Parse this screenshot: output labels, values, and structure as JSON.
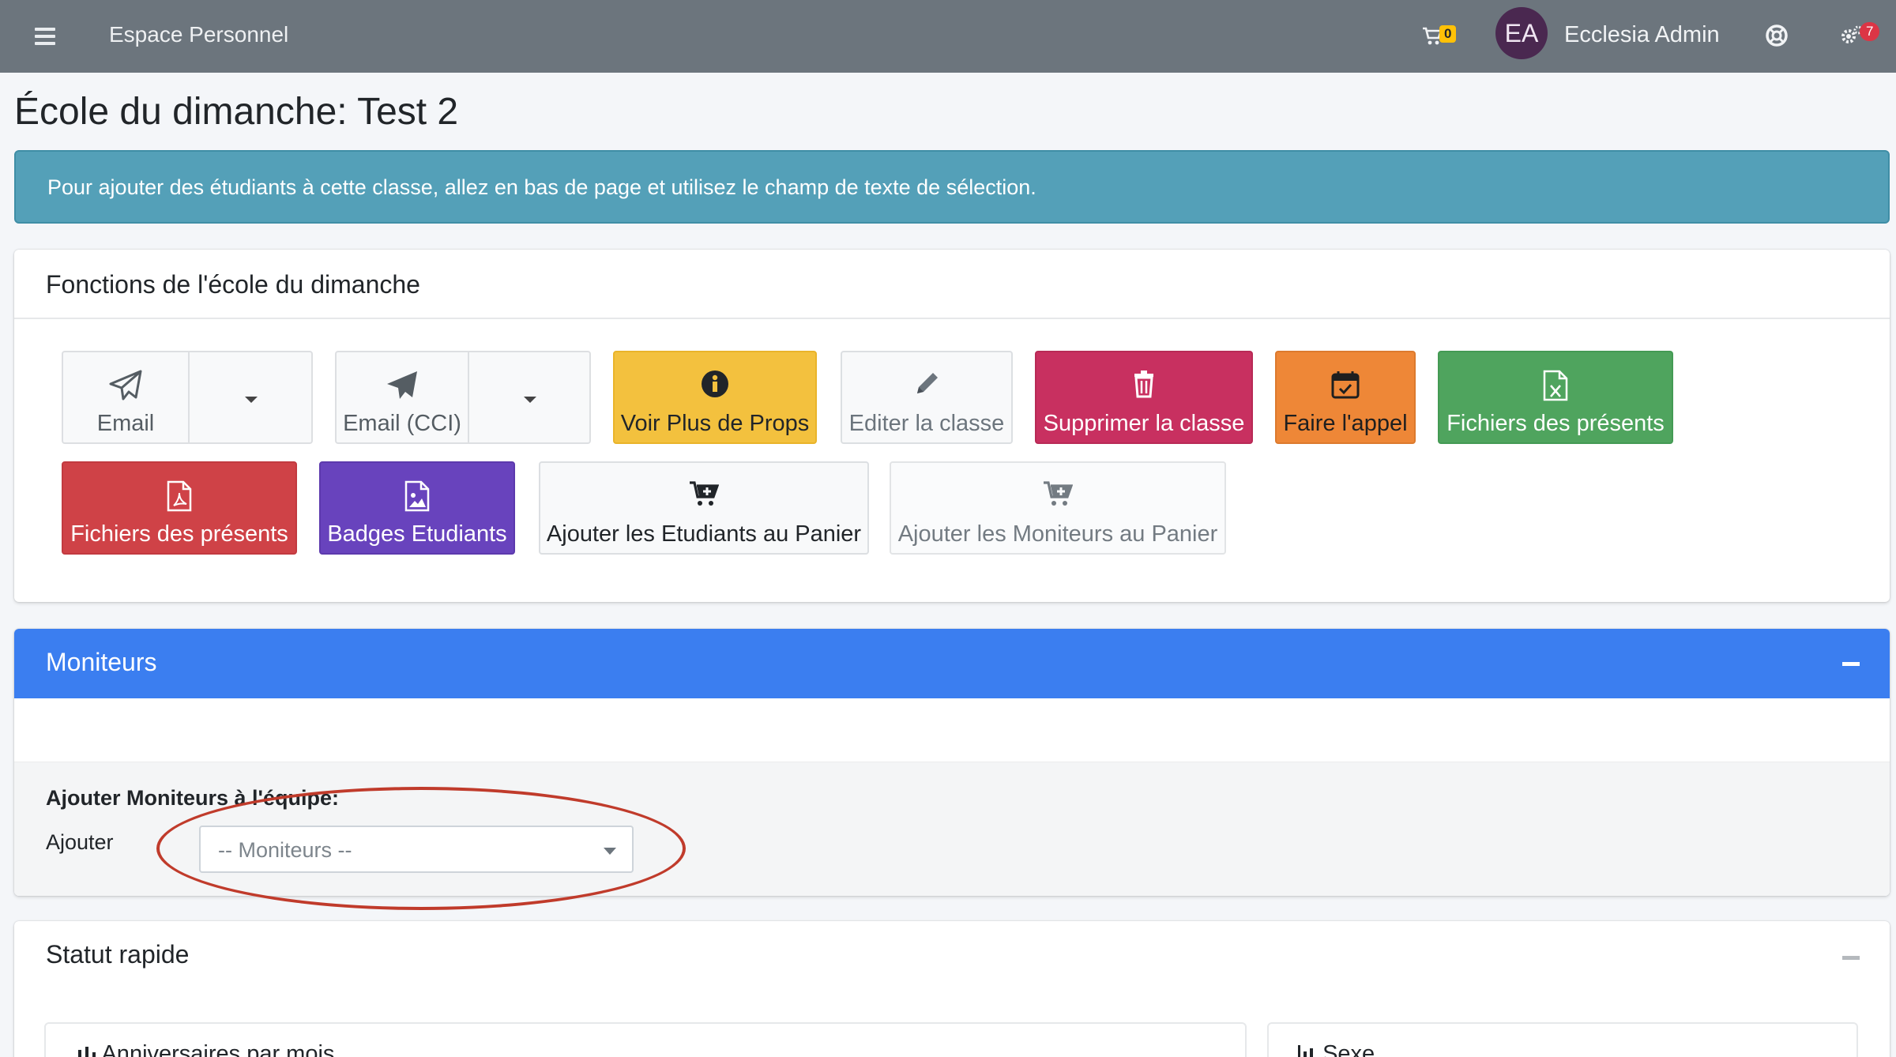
{
  "navbar": {
    "menu_icon": "bars-icon",
    "brand": "Espace Personnel",
    "cart_count": "0",
    "avatar_initials": "EA",
    "user_name": "Ecclesia Admin",
    "help_icon": "life-ring-icon",
    "gear_badge": "7"
  },
  "page": {
    "title": "École du dimanche: Test 2"
  },
  "alert": {
    "text": "Pour ajouter des étudiants à cette classe, allez en bas de page et utilisez le champ de texte de sélection."
  },
  "functions_card": {
    "title": "Fonctions de l'école du dimanche",
    "buttons": {
      "email": "Email",
      "email_bcc": "Email (CCI)",
      "view_props": "Voir Plus de Props",
      "edit_class": "Editer la classe",
      "delete_class": "Supprimer la classe",
      "attendance": "Faire l'appel",
      "attendance_xls": "Fichiers des présents",
      "attendance_pdf": "Fichiers des présents",
      "badges": "Badges Etudiants",
      "add_students_cart": "Ajouter les Etudiants au Panier",
      "add_monitors_cart": "Ajouter les Moniteurs au Panier"
    }
  },
  "monitors_card": {
    "title": "Moniteurs",
    "add_title": "Ajouter Moniteurs à l'équipe:",
    "add_label": "Ajouter",
    "select_placeholder": "-- Moniteurs --"
  },
  "status_card": {
    "title": "Statut rapide",
    "birthdays_title": "Anniversaires par mois",
    "gender_title": "Sexe"
  },
  "colors": {
    "navbar": "#6c757d",
    "info": "#54a0b8",
    "primary": "#3b7ef0",
    "warning": "#f3c13e",
    "danger": "#cf4247",
    "success": "#4fa45e",
    "purple": "#6843bd",
    "orange": "#ee8737",
    "crimson": "#c83060",
    "highlight": "#c03b2b"
  }
}
